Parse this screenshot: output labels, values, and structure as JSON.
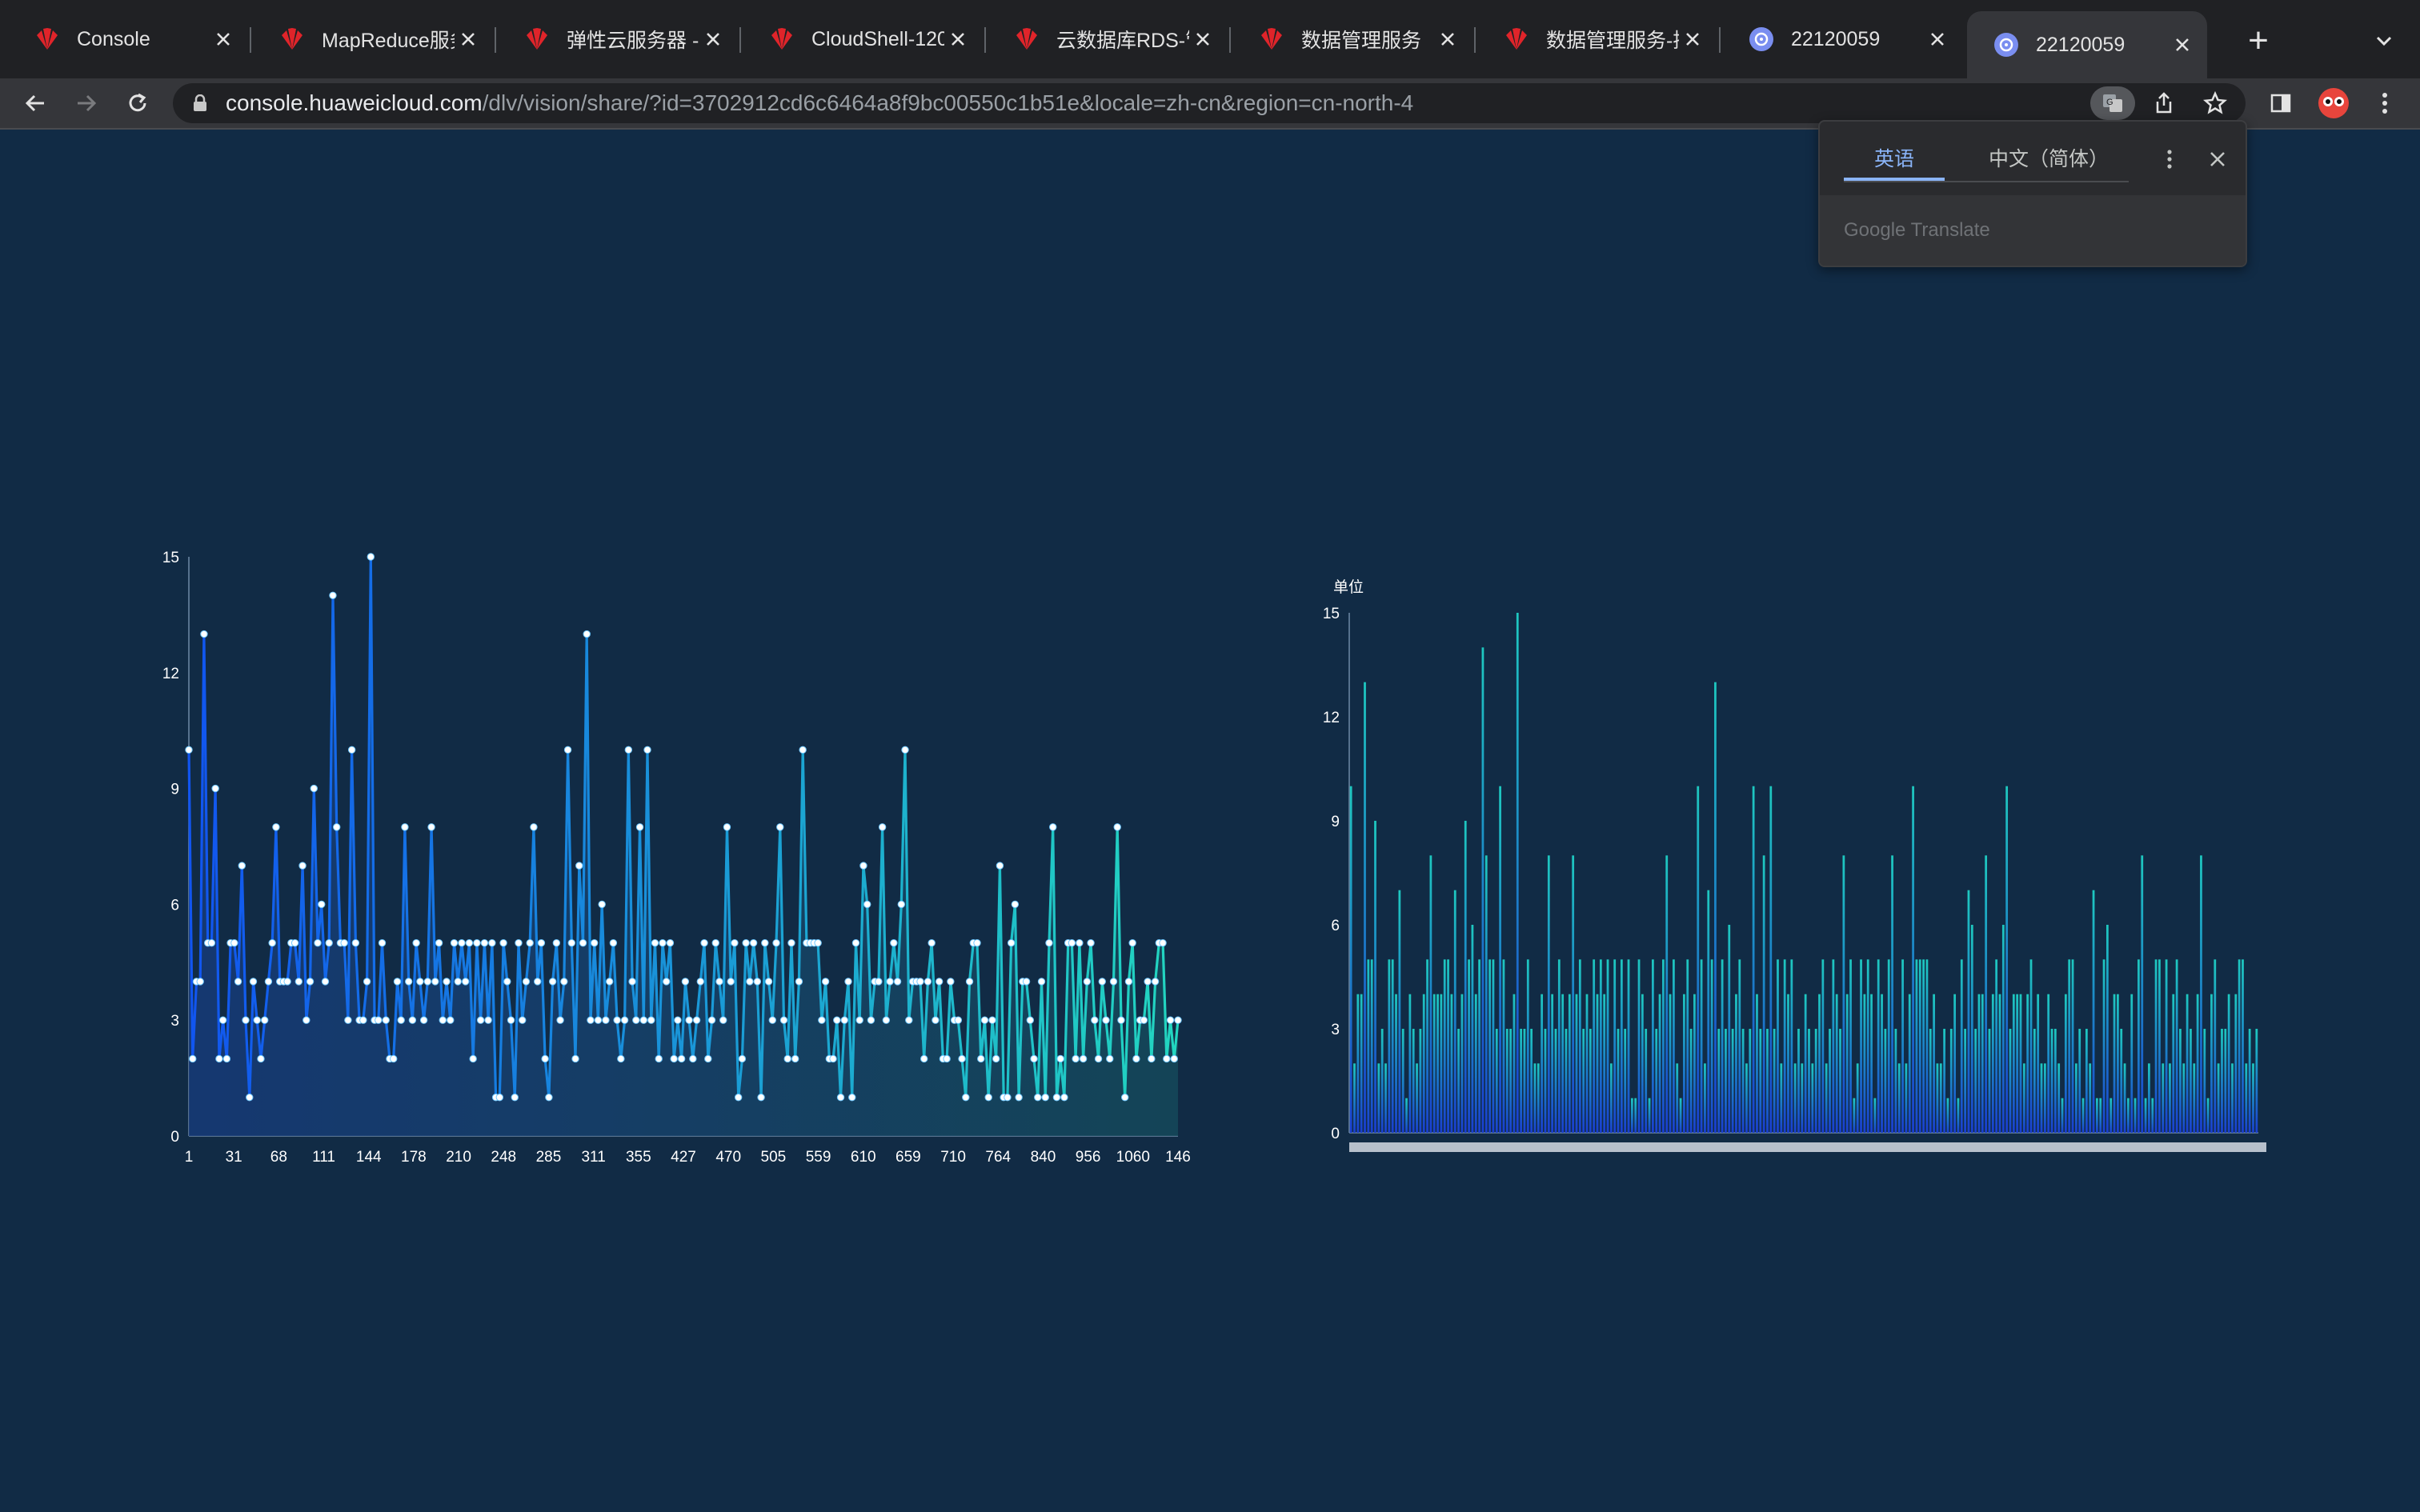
{
  "browser": {
    "tabs": [
      {
        "title": "Console",
        "icon": "huawei-icon",
        "active": false
      },
      {
        "title": "MapReduce服务",
        "icon": "huawei-icon",
        "active": false
      },
      {
        "title": "弹性云服务器 - 拉",
        "icon": "huawei-icon",
        "active": false
      },
      {
        "title": "CloudShell-120",
        "icon": "huawei-icon",
        "active": false
      },
      {
        "title": "云数据库RDS-管",
        "icon": "huawei-icon",
        "active": false
      },
      {
        "title": "数据管理服务",
        "icon": "huawei-icon",
        "active": false
      },
      {
        "title": "数据管理服务-控",
        "icon": "huawei-icon",
        "active": false
      },
      {
        "title": "22120059",
        "icon": "dlv-icon",
        "active": false
      },
      {
        "title": "22120059",
        "icon": "dlv-icon",
        "active": true
      }
    ],
    "url_host": "console.huaweicloud.com",
    "url_path": "/dlv/vision/share/?id=3702912cd6c6464a8f9bc00550c1b51e&locale=zh-cn&region=cn-north-4",
    "toolbar_icons": [
      "back-icon",
      "forward-icon",
      "reload-icon",
      "lock-icon",
      "translate-icon",
      "share-icon",
      "bookmark-star-icon",
      "side-panel-icon",
      "profile-avatar",
      "menu-icon"
    ]
  },
  "translate_popup": {
    "tab_source": "英语",
    "tab_target": "中文（简体）",
    "brand": "Google Translate"
  },
  "colors": {
    "page_bg": "#112b45",
    "line_start": "#1155f0",
    "line_end": "#22d6c0",
    "bar_bottom": "#1a3fd0",
    "bar_top": "#1ec8c0"
  },
  "chart_data": [
    {
      "type": "line",
      "ylim": [
        0,
        15
      ],
      "yticks": [
        "0",
        "3",
        "6",
        "9",
        "12",
        "15"
      ],
      "xticks": [
        "1",
        "31",
        "68",
        "111",
        "144",
        "178",
        "210",
        "248",
        "285",
        "311",
        "355",
        "427",
        "470",
        "505",
        "559",
        "610",
        "659",
        "710",
        "764",
        "840",
        "956",
        "1060",
        "146"
      ],
      "values": [
        10,
        2,
        4,
        4,
        13,
        5,
        5,
        9,
        2,
        3,
        2,
        5,
        5,
        4,
        7,
        3,
        1,
        4,
        3,
        2,
        3,
        4,
        5,
        8,
        4,
        4,
        4,
        5,
        5,
        4,
        7,
        3,
        4,
        9,
        5,
        6,
        4,
        5,
        14,
        8,
        5,
        5,
        3,
        10,
        5,
        3,
        3,
        4,
        15,
        3,
        3,
        5,
        3,
        2,
        2,
        4,
        3,
        8,
        4,
        3,
        5,
        4,
        3,
        4,
        8,
        4,
        5,
        3,
        4,
        3,
        5,
        4,
        5,
        4,
        5,
        2,
        5,
        3,
        5,
        3,
        5,
        1,
        1,
        5,
        4,
        3,
        1,
        5,
        3,
        4,
        5,
        8,
        4,
        5,
        2,
        1,
        4,
        5,
        3,
        4,
        10,
        5,
        2,
        7,
        5,
        13,
        3,
        5,
        3,
        6,
        3,
        4,
        5,
        3,
        2,
        3,
        10,
        4,
        3,
        8,
        3,
        10,
        3,
        5,
        2,
        5,
        4,
        5,
        2,
        3,
        2,
        4,
        3,
        2,
        3,
        4,
        5,
        2,
        3,
        5,
        4,
        3,
        8,
        4,
        5,
        1,
        2,
        5,
        4,
        5,
        4,
        1,
        5,
        4,
        3,
        5,
        8,
        3,
        2,
        5,
        2,
        4,
        10,
        5,
        5,
        5,
        5,
        3,
        4,
        2,
        2,
        3,
        1,
        3,
        4,
        1,
        5,
        3,
        7,
        6,
        3,
        4,
        4,
        8,
        3,
        4,
        5,
        4,
        6,
        10,
        3,
        4,
        4,
        4,
        2,
        4,
        5,
        3,
        4,
        2,
        2,
        4,
        3,
        3,
        2,
        1,
        4,
        5,
        5,
        2,
        3,
        1,
        3,
        2,
        7,
        1,
        1,
        5,
        6,
        1,
        4,
        4,
        3,
        2,
        1,
        4,
        1,
        5,
        8,
        1,
        2,
        1,
        5,
        5,
        2,
        5,
        2,
        4,
        5,
        3,
        2,
        4,
        3,
        2,
        4,
        8,
        3,
        1,
        4,
        5,
        2,
        3,
        3,
        4,
        2,
        4,
        5,
        5,
        2,
        3,
        2,
        3
      ]
    },
    {
      "type": "bar",
      "ylabel": "单位",
      "ylim": [
        0,
        15
      ],
      "yticks": [
        "0",
        "3",
        "6",
        "9",
        "12",
        "15"
      ],
      "values": [
        10,
        2,
        4,
        4,
        13,
        5,
        5,
        9,
        2,
        3,
        2,
        5,
        5,
        4,
        7,
        3,
        1,
        4,
        3,
        2,
        3,
        4,
        5,
        8,
        4,
        4,
        4,
        5,
        5,
        4,
        7,
        3,
        4,
        9,
        5,
        6,
        4,
        5,
        14,
        8,
        5,
        5,
        3,
        10,
        5,
        3,
        3,
        4,
        15,
        3,
        3,
        5,
        3,
        2,
        2,
        4,
        3,
        8,
        4,
        3,
        5,
        4,
        3,
        4,
        8,
        4,
        5,
        3,
        4,
        3,
        5,
        4,
        5,
        4,
        5,
        2,
        5,
        3,
        5,
        3,
        5,
        1,
        1,
        5,
        4,
        3,
        1,
        5,
        3,
        4,
        5,
        8,
        4,
        5,
        2,
        1,
        4,
        5,
        3,
        4,
        10,
        5,
        2,
        7,
        5,
        13,
        3,
        5,
        3,
        6,
        3,
        4,
        5,
        3,
        2,
        3,
        10,
        4,
        3,
        8,
        3,
        10,
        3,
        5,
        2,
        5,
        4,
        5,
        2,
        3,
        2,
        4,
        3,
        2,
        3,
        4,
        5,
        2,
        3,
        5,
        4,
        3,
        8,
        4,
        5,
        1,
        2,
        5,
        4,
        5,
        4,
        1,
        5,
        4,
        3,
        5,
        8,
        3,
        2,
        5,
        2,
        4,
        10,
        5,
        5,
        5,
        5,
        3,
        4,
        2,
        2,
        3,
        1,
        3,
        4,
        1,
        5,
        3,
        7,
        6,
        3,
        4,
        4,
        8,
        3,
        4,
        5,
        4,
        6,
        10,
        3,
        4,
        4,
        4,
        2,
        4,
        5,
        3,
        4,
        2,
        2,
        4,
        3,
        3,
        2,
        1,
        4,
        5,
        5,
        2,
        3,
        1,
        3,
        2,
        7,
        1,
        1,
        5,
        6,
        1,
        4,
        4,
        3,
        2,
        1,
        4,
        1,
        5,
        8,
        1,
        2,
        1,
        5,
        5,
        2,
        5,
        2,
        4,
        5,
        3,
        2,
        4,
        3,
        2,
        4,
        8,
        3,
        1,
        4,
        5,
        2,
        3,
        3,
        4,
        2,
        4,
        5,
        5,
        2,
        3,
        2,
        3
      ]
    }
  ]
}
